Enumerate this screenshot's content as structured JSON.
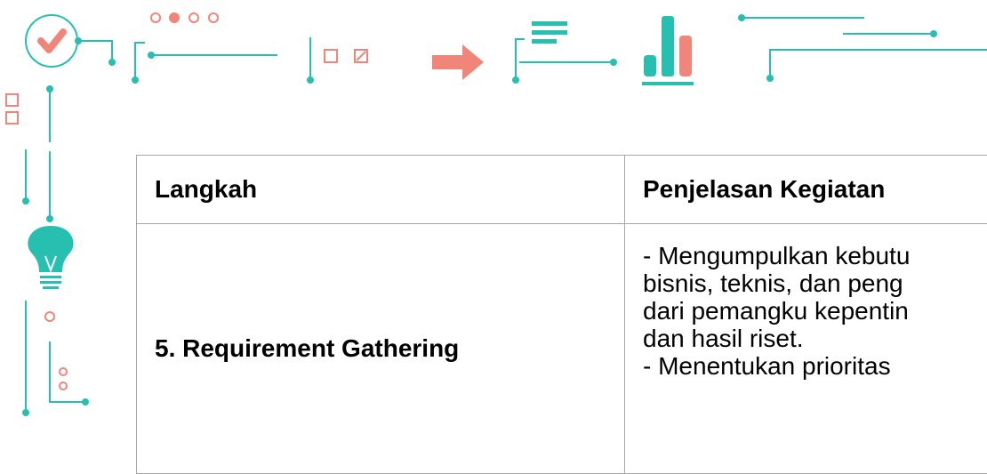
{
  "table": {
    "headers": [
      "Langkah",
      "Penjelasan Kegiatan"
    ],
    "rows": [
      {
        "step": "5. Requirement Gathering",
        "description": "- Mengumpulkan kebutu\nbisnis, teknis, dan peng\ndari pemangku kepentin\ndan hasil riset.\n- Menentukan prioritas"
      }
    ]
  },
  "colors": {
    "teal": "#26bfb0",
    "salmon": "#f0857a",
    "border": "#a8a8a8"
  },
  "icons": [
    "check-icon",
    "lightbulb-icon",
    "arrow-right-icon",
    "menu-lines-icon",
    "bar-chart-icon",
    "square-icon",
    "checked-square-icon",
    "dot-pager-icon"
  ]
}
